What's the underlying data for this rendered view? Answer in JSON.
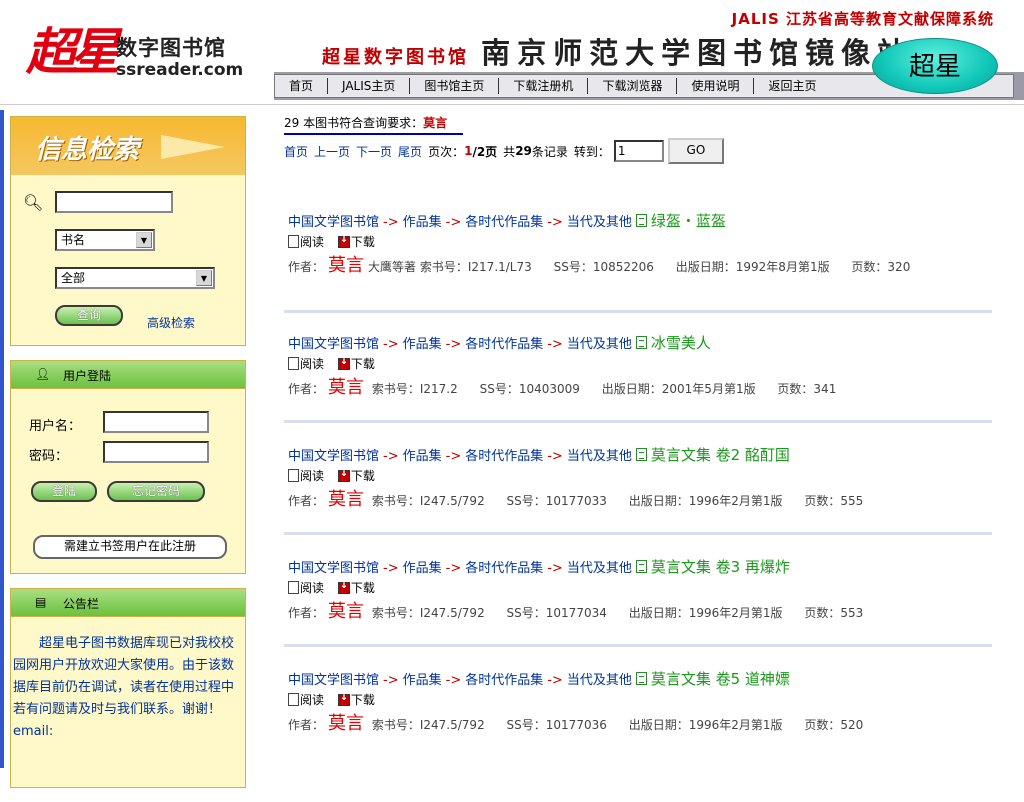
{
  "header": {
    "logo_mark": "超星",
    "logo_cn": "数字图书馆",
    "logo_url": "ssreader.com",
    "jalis": "JALIS 江苏省高等教育文献保障系统",
    "banner_a": "超星数字图书馆",
    "banner_b": "南京师范大学图书馆镜像站",
    "badge": "超星",
    "nav": [
      "首页",
      "JALIS主页",
      "图书馆主页",
      "下载注册机",
      "下载浏览器",
      "使用说明",
      "返回主页"
    ]
  },
  "search_panel": {
    "title": "信息检索",
    "field_select": "书名",
    "scope_select": "全部",
    "query_button": "查询",
    "advanced_link": "高级检索"
  },
  "login_panel": {
    "title": "用户登陆",
    "username_label": "用户名：",
    "password_label": "密码：",
    "login_button": "登陆",
    "forgot_button": "忘记密码",
    "register_button": "需建立书签用户在此注册"
  },
  "notice_panel": {
    "title": "公告栏",
    "text": "超星电子图书数据库现已对我校校园网用户开放欢迎大家使用。由于该数据库目前仍在调试，读者在使用过程中若有问题请及时与我们联系。谢谢！ email:"
  },
  "results": {
    "count_text": "29 本图书符合查询要求：",
    "keyword": "莫言",
    "pager": {
      "first": "首页",
      "prev": "上一页",
      "next": "下一页",
      "last": "尾页",
      "page_label": "页次：",
      "page_current": "1",
      "page_total": "/2页",
      "total_pre": "共",
      "total_count": "29",
      "total_post": "条记录",
      "goto_label": "转到：",
      "goto_value": "1",
      "go_button": "GO"
    },
    "read_label": "阅读",
    "download_label": "下载",
    "path": [
      "中国文学图书馆",
      "作品集",
      "各时代作品集",
      "当代及其他"
    ],
    "path_arrow": "->",
    "labels": {
      "author": "作者：",
      "call_no": "索书号：",
      "ss_no": "SS号：",
      "pub_date": "出版日期：",
      "pages": "页数："
    },
    "records": [
      {
        "title": "绿盔・蓝盔",
        "author": "莫言",
        "coauthor": "大鹰等著",
        "call_no": "I217.1/L73",
        "ss_no": "10852206",
        "pub_date": "1992年8月第1版",
        "pages": "320"
      },
      {
        "title": "冰雪美人",
        "author": "莫言",
        "coauthor": "",
        "call_no": "I217.2",
        "ss_no": "10403009",
        "pub_date": "2001年5月第1版",
        "pages": "341"
      },
      {
        "title": "莫言文集 卷2 酩酊国",
        "author": "莫言",
        "coauthor": "",
        "call_no": "I247.5/792",
        "ss_no": "10177033",
        "pub_date": "1996年2月第1版",
        "pages": "555"
      },
      {
        "title": "莫言文集 卷3 再爆炸",
        "author": "莫言",
        "coauthor": "",
        "call_no": "I247.5/792",
        "ss_no": "10177034",
        "pub_date": "1996年2月第1版",
        "pages": "553"
      },
      {
        "title": "莫言文集 卷5 道神嫖",
        "author": "莫言",
        "coauthor": "",
        "call_no": "I247.5/792",
        "ss_no": "10177036",
        "pub_date": "1996年2月第1版",
        "pages": "520"
      }
    ]
  },
  "colors": {
    "accent_red": "#c00000",
    "link_blue": "#003399",
    "title_green": "#1a9a1a",
    "panel_yellow": "#fff8c8"
  }
}
